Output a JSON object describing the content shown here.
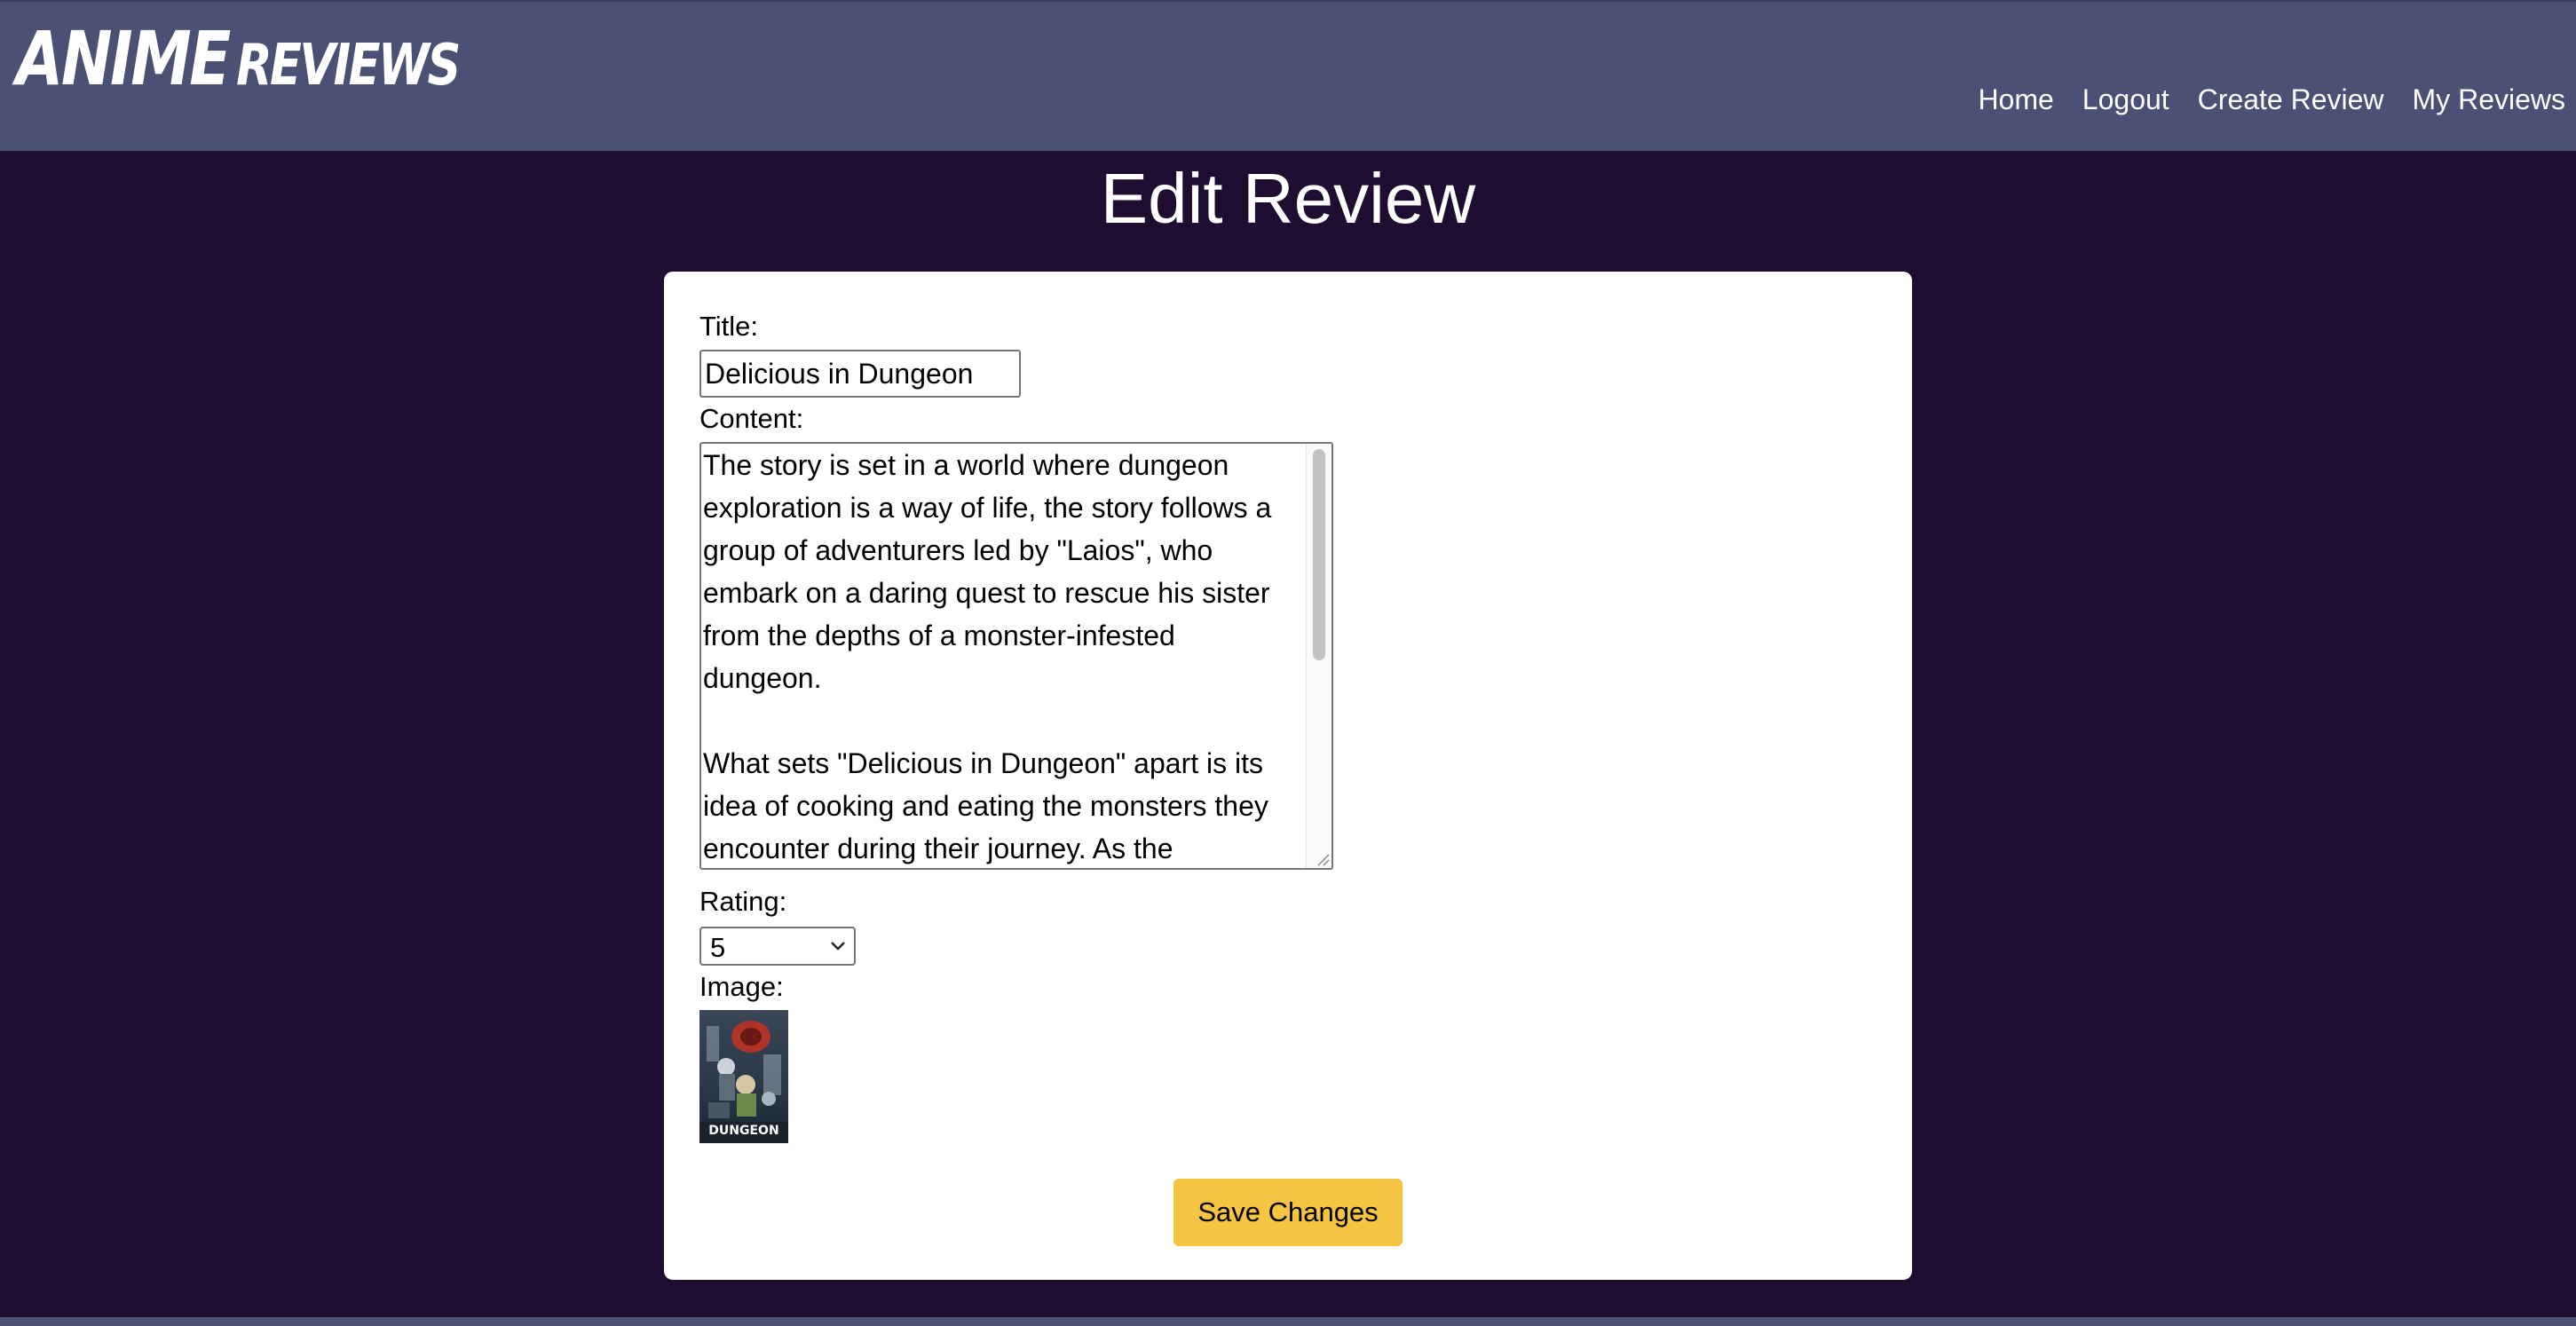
{
  "header": {
    "logo_main": "Anime",
    "logo_sub": "Reviews",
    "nav": [
      "Home",
      "Logout",
      "Create Review",
      "My Reviews"
    ]
  },
  "page": {
    "title": "Edit Review"
  },
  "form": {
    "title_label": "Title:",
    "title_value": "Delicious in Dungeon",
    "content_label": "Content:",
    "content_value": "The story is set in a world where dungeon exploration is a way of life, the story follows a group of adventurers led by \"Laios\", who embark on a daring quest to rescue his sister from the depths of a monster-infested dungeon.\n\nWhat sets \"Delicious in Dungeon\" apart is its idea of cooking and eating the monsters they encounter during their journey. As the",
    "rating_label": "Rating:",
    "rating_value": "5",
    "image_label": "Image:",
    "poster_text": "DUNGEON",
    "save_label": "Save Changes"
  },
  "colors": {
    "background": "#1f0c31",
    "header": "#4b5075",
    "button": "#f5c443",
    "card": "#ffffff"
  }
}
